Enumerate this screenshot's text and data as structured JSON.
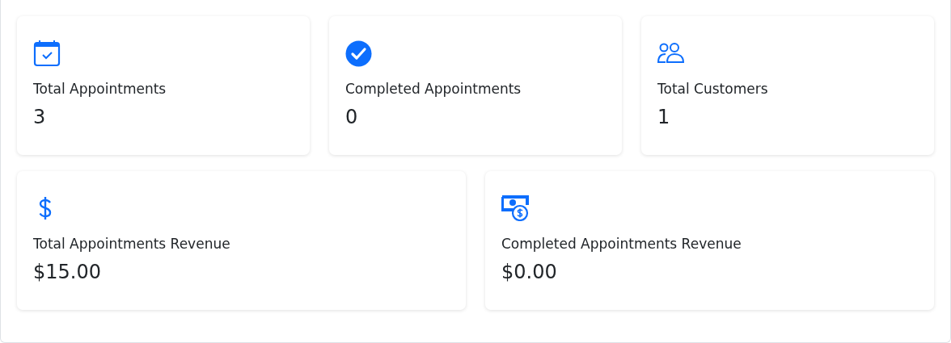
{
  "rows": [
    {
      "cards": [
        {
          "label": "Total Appointments",
          "value": "3"
        },
        {
          "label": "Completed Appointments",
          "value": "0"
        },
        {
          "label": "Total Customers",
          "value": "1"
        }
      ]
    },
    {
      "cards": [
        {
          "label": "Total Appointments Revenue",
          "value": "$15.00"
        },
        {
          "label": "Completed Appointments Revenue",
          "value": "$0.00"
        }
      ]
    }
  ]
}
